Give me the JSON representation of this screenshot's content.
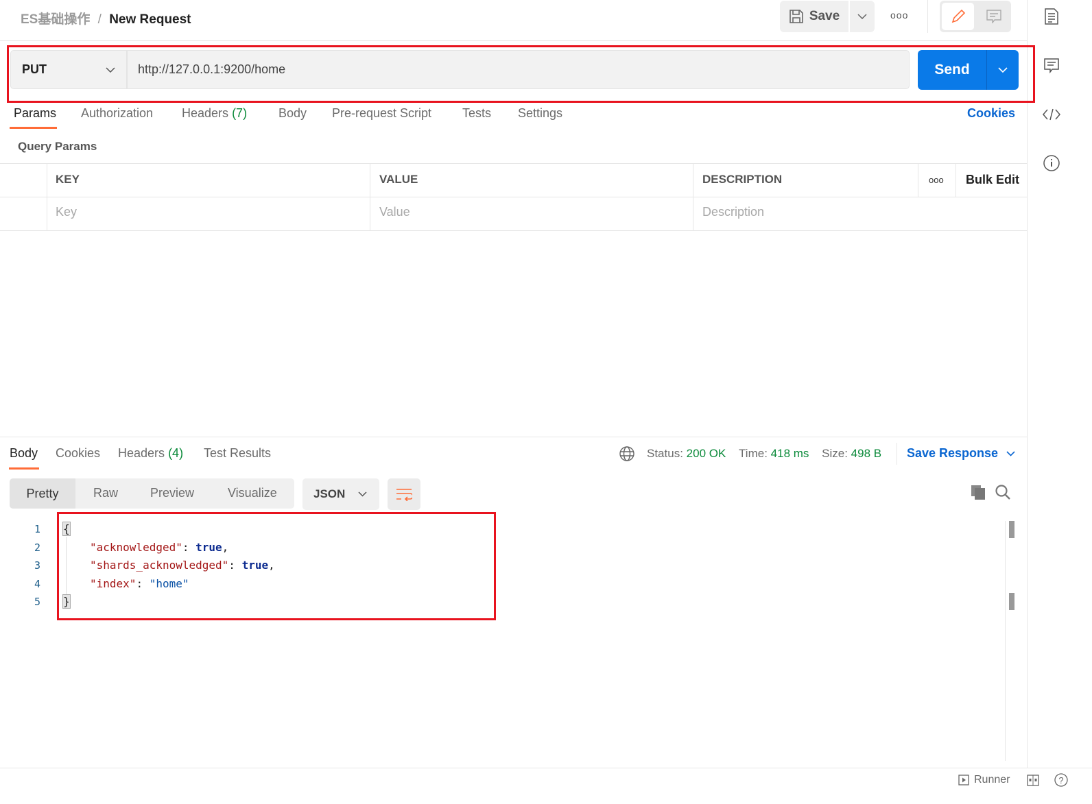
{
  "breadcrumb": {
    "collection": "ES基础操作",
    "separator": "/",
    "request": "New Request"
  },
  "toolbar": {
    "save_label": "Save",
    "more": "ooo"
  },
  "request": {
    "method": "PUT",
    "url": "http://127.0.0.1:9200/home",
    "send_label": "Send"
  },
  "tabs": [
    {
      "label": "Params",
      "active": true
    },
    {
      "label": "Authorization"
    },
    {
      "label": "Headers",
      "count": "(7)"
    },
    {
      "label": "Body"
    },
    {
      "label": "Pre-request Script"
    },
    {
      "label": "Tests"
    },
    {
      "label": "Settings"
    }
  ],
  "cookies_link": "Cookies",
  "query_params": {
    "title": "Query Params",
    "columns": [
      "KEY",
      "VALUE",
      "DESCRIPTION"
    ],
    "more": "ooo",
    "bulk_edit": "Bulk Edit",
    "placeholders": {
      "key": "Key",
      "value": "Value",
      "description": "Description"
    }
  },
  "response": {
    "tabs": [
      {
        "label": "Body",
        "active": true
      },
      {
        "label": "Cookies"
      },
      {
        "label": "Headers",
        "count": "(4)"
      },
      {
        "label": "Test Results"
      }
    ],
    "status_label": "Status:",
    "status": "200 OK",
    "time_label": "Time:",
    "time": "418 ms",
    "size_label": "Size:",
    "size": "498 B",
    "save_response": "Save Response",
    "view_modes": [
      "Pretty",
      "Raw",
      "Preview",
      "Visualize"
    ],
    "format": "JSON",
    "lines": [
      "1",
      "2",
      "3",
      "4",
      "5"
    ],
    "code": {
      "open": "{",
      "k1": "\"acknowledged\"",
      "v1": "true",
      "k2": "\"shards_acknowledged\"",
      "v2": "true",
      "k3": "\"index\"",
      "v3": "\"home\"",
      "close": "}",
      "colon": ": ",
      "comma": ","
    }
  },
  "footer": {
    "runner": "Runner"
  },
  "colors": {
    "accent": "#ff6c37",
    "send": "#0a7ae8",
    "highlight": "#e8131e"
  }
}
